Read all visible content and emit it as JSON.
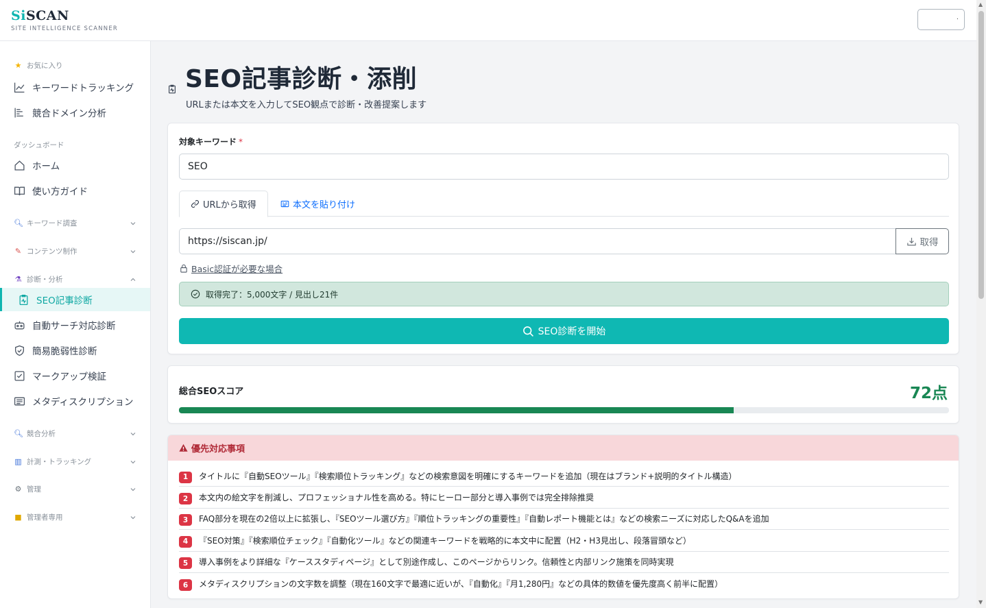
{
  "app": {
    "logo_main_prefix": "Si",
    "logo_main_suffix": "SCAN",
    "logo_sub": "SITE INTELLIGENCE SCANNER",
    "top_select_value": "."
  },
  "sidebar": {
    "favorites_label": "お気に入り",
    "favorites": [
      {
        "label": "キーワードトラッキング",
        "icon": "line-chart-icon"
      },
      {
        "label": "競合ドメイン分析",
        "icon": "bar-list-icon"
      }
    ],
    "dashboard_label": "ダッシュボード",
    "dashboard": [
      {
        "label": "ホーム",
        "icon": "home-icon"
      },
      {
        "label": "使い方ガイド",
        "icon": "book-icon"
      }
    ],
    "sections": {
      "keyword_research": "キーワード調査",
      "content": "コンテンツ制作",
      "diagnosis": "診断・分析",
      "competitor": "競合分析",
      "tracking": "計測・トラッキング",
      "admin": "管理",
      "admin_only": "管理者専用"
    },
    "diagnosis_items": [
      {
        "label": "SEO記事診断",
        "icon": "clipboard-pulse-icon",
        "active": true
      },
      {
        "label": "自動サーチ対応診断",
        "icon": "robot-icon"
      },
      {
        "label": "簡易脆弱性診断",
        "icon": "shield-check-icon"
      },
      {
        "label": "マークアップ検証",
        "icon": "check-square-icon"
      },
      {
        "label": "メタディスクリプション",
        "icon": "card-text-icon"
      }
    ]
  },
  "page": {
    "title": "SEO記事診断・添削",
    "subtitle": "URLまたは本文を入力してSEO観点で診断・改善提案します"
  },
  "form": {
    "keyword_label": "対象キーワード",
    "required_mark": "*",
    "keyword_value": "SEO",
    "tab_url": "URLから取得",
    "tab_paste": "本文を貼り付け",
    "url_value": "https://siscan.jp/",
    "fetch_label": "取得",
    "basic_auth_link": "Basic認証が必要な場合",
    "fetch_status": "取得完了：5,000文字 / 見出し21件",
    "start_label": "SEO診断を開始"
  },
  "score": {
    "label": "総合SEOスコア",
    "value_text": "72点",
    "percent": 72,
    "color": "#198754"
  },
  "priority": {
    "header": "優先対応事項",
    "items": [
      {
        "num": "1",
        "text": "タイトルに『自動SEOツール』『検索順位トラッキング』などの検索意図を明確にするキーワードを追加（現在はブランド+説明的タイトル構造）"
      },
      {
        "num": "2",
        "text": "本文内の絵文字を削減し、プロフェッショナル性を高める。特にヒーロー部分と導入事例では完全排除推奨"
      },
      {
        "num": "3",
        "text": "FAQ部分を現在の2倍以上に拡張し、『SEOツール選び方』『順位トラッキングの重要性』『自動レポート機能とは』などの検索ニーズに対応したQ&Aを追加"
      },
      {
        "num": "4",
        "text": "『SEO対策』『検索順位チェック』『自動化ツール』などの関連キーワードを戦略的に本文中に配置（H2・H3見出し、段落冒頭など）"
      },
      {
        "num": "5",
        "text": "導入事例をより詳細な『ケーススタディページ』として別途作成し、このページからリンク。信頼性と内部リンク施策を同時実現"
      },
      {
        "num": "6",
        "text": "メタディスクリプションの文字数を調整（現在160文字で最適に近いが、『自動化』『月1,280円』などの具体的数値を優先度高く前半に配置）"
      }
    ]
  },
  "colors": {
    "accent": "#0fb5b0",
    "success": "#198754",
    "danger": "#dc3545",
    "alert_success_bg": "#d1e7dd",
    "alert_danger_bg": "#f8d7da"
  }
}
